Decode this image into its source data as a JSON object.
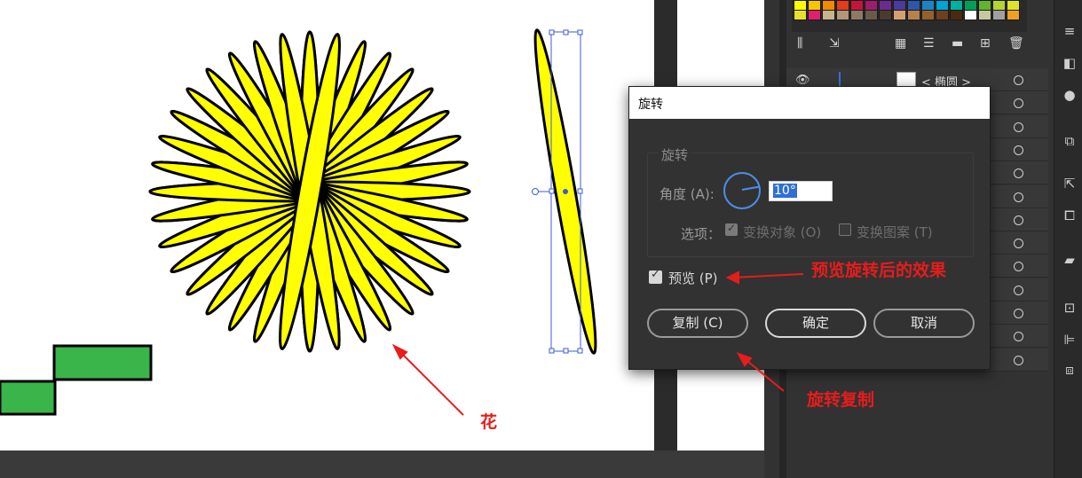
{
  "dialog": {
    "title": "旋转",
    "group_label": "旋转",
    "angle_label": "角度 (A):",
    "angle_value": "10°",
    "options_label": "选项：",
    "transform_objects_label": "变换对象 (O)",
    "transform_patterns_label": "变换图案 (T)",
    "preview_label": "预览 (P)",
    "copy_button": "复制 (C)",
    "ok_button": "确定",
    "cancel_button": "取消"
  },
  "layers": {
    "layer_name": "< 椭圆 >"
  },
  "annotations": {
    "preview_note": "预览旋转后的效果",
    "copy_note": "旋转复制",
    "flower_note": "花"
  },
  "colors": {
    "petal_fill": "#ffff00",
    "step_fill": "#39b54a",
    "annotation": "#e81c1c",
    "selection": "#3b5bdb"
  }
}
